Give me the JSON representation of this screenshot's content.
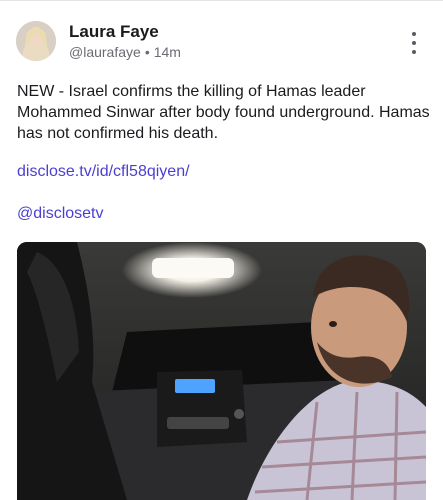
{
  "post": {
    "author": {
      "name": "Laura Faye",
      "handle": "@laurafaye",
      "separator": "•",
      "time": "14m"
    },
    "text": "NEW - Israel confirms the killing of Hamas leader Mohammed Sinwar after body found underground. Hamas has not confirmed his death.",
    "link_url": "disclose.tv/id/cfl58qiyen/",
    "mention": "@disclosetv",
    "more_icon": "more-vertical-icon",
    "media_description_icon": "video-thumbnail"
  },
  "colors": {
    "link": "#4b3fd0",
    "text": "#1b1b1f",
    "muted": "#6b6b73"
  }
}
